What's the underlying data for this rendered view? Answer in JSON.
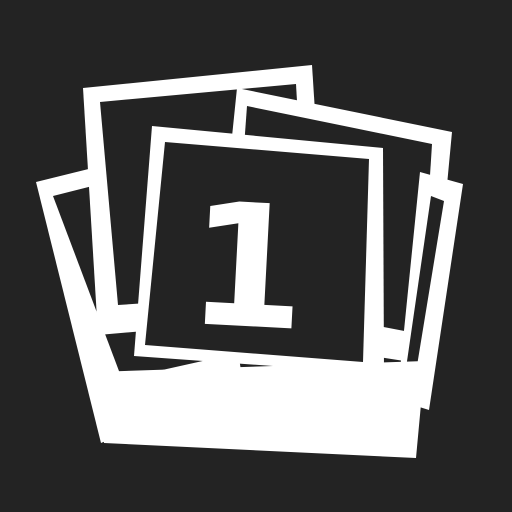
{
  "app_icon": {
    "icon": "photo-stack-icon",
    "badge_count": "1",
    "colors": {
      "background": "#232323",
      "foreground": "#ffffff"
    }
  }
}
